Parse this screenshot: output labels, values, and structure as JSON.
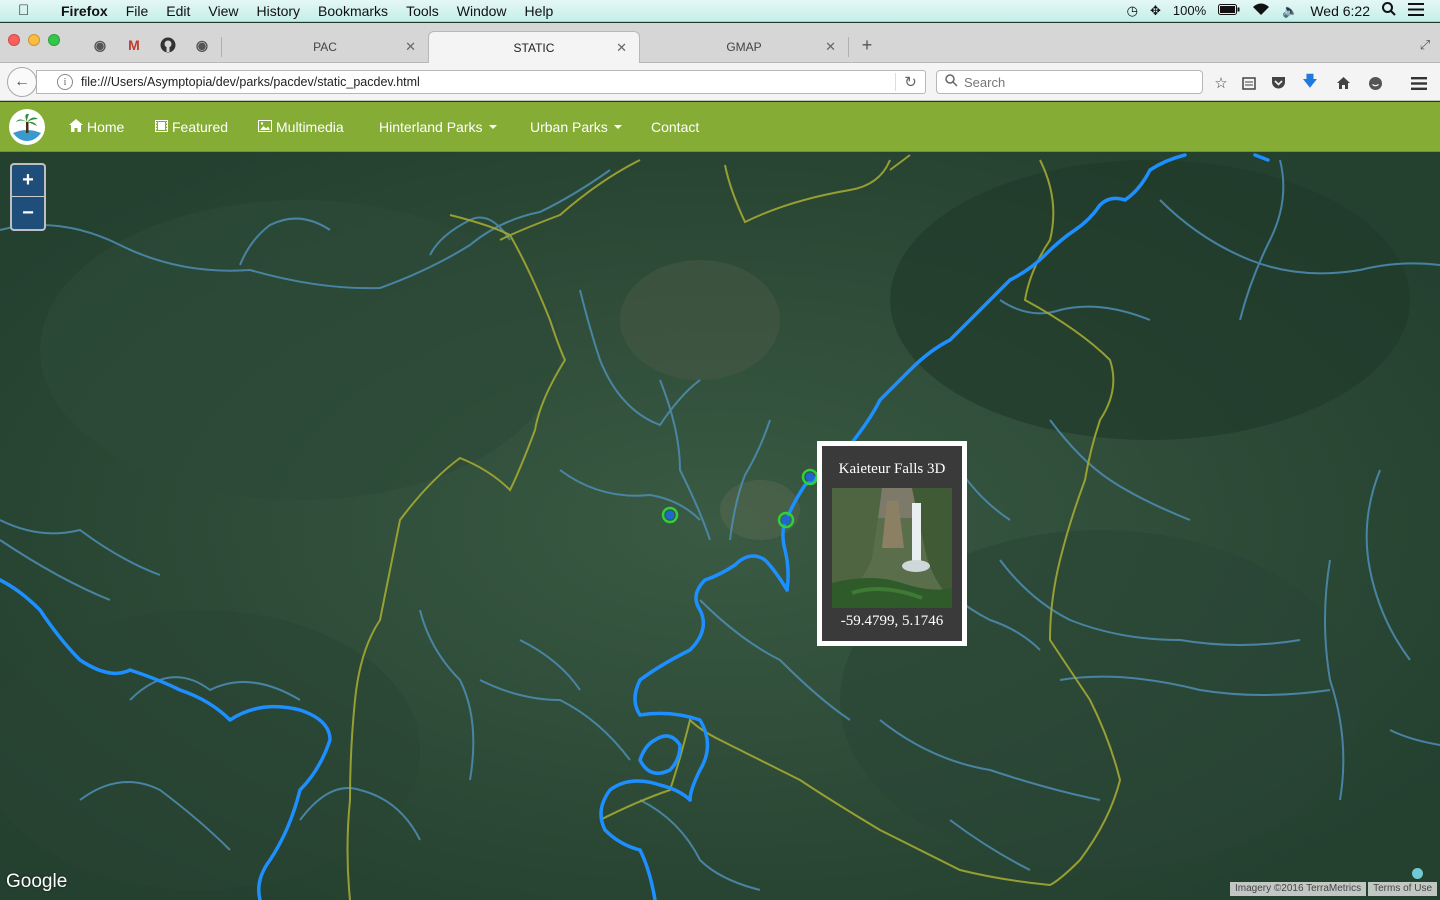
{
  "menubar": {
    "app": "Firefox",
    "items": [
      "File",
      "Edit",
      "View",
      "History",
      "Bookmarks",
      "Tools",
      "Window",
      "Help"
    ],
    "battery": "100%",
    "clock": "Wed 6:22"
  },
  "tabs": [
    {
      "label": "PAC"
    },
    {
      "label": "STATIC"
    },
    {
      "label": "GMAP"
    }
  ],
  "address": {
    "url": "file:///Users/Asymptopia/dev/parks/pacdev/static_pacdev.html",
    "search_placeholder": "Search"
  },
  "sitenav": {
    "items": [
      "Home",
      "Featured",
      "Multimedia",
      "Hinterland Parks",
      "Urban Parks",
      "Contact"
    ]
  },
  "map": {
    "zoom_in": "+",
    "zoom_out": "−",
    "popup": {
      "title": "Kaieteur Falls 3D",
      "coords": "-59.4799, 5.1746"
    },
    "google": "Google",
    "attribution": "Imagery ©2016 TerraMetrics",
    "terms": "Terms of Use"
  },
  "colors": {
    "nav_green": "#85ad35",
    "river_main": "#1e8fff",
    "river_minor": "#4e8fb5",
    "boundary": "#a3a832",
    "marker": "#2fd03a"
  }
}
